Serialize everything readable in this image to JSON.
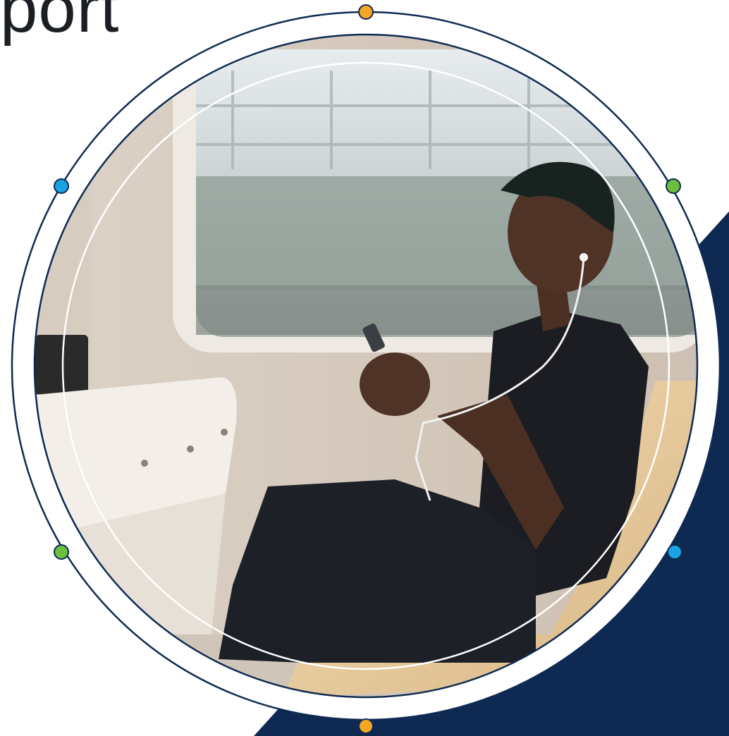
{
  "page": {
    "partial_title": "port",
    "colors": {
      "navy": "#0f2a52",
      "ring_stroke": "#0f2a52",
      "dot_orange": "#f5a623",
      "dot_blue": "#1aa3e0",
      "dot_green": "#6cbf3c"
    }
  },
  "photo": {
    "subject": "person-on-train-with-phone",
    "icons": [
      "earphones-icon",
      "phone-icon"
    ]
  }
}
